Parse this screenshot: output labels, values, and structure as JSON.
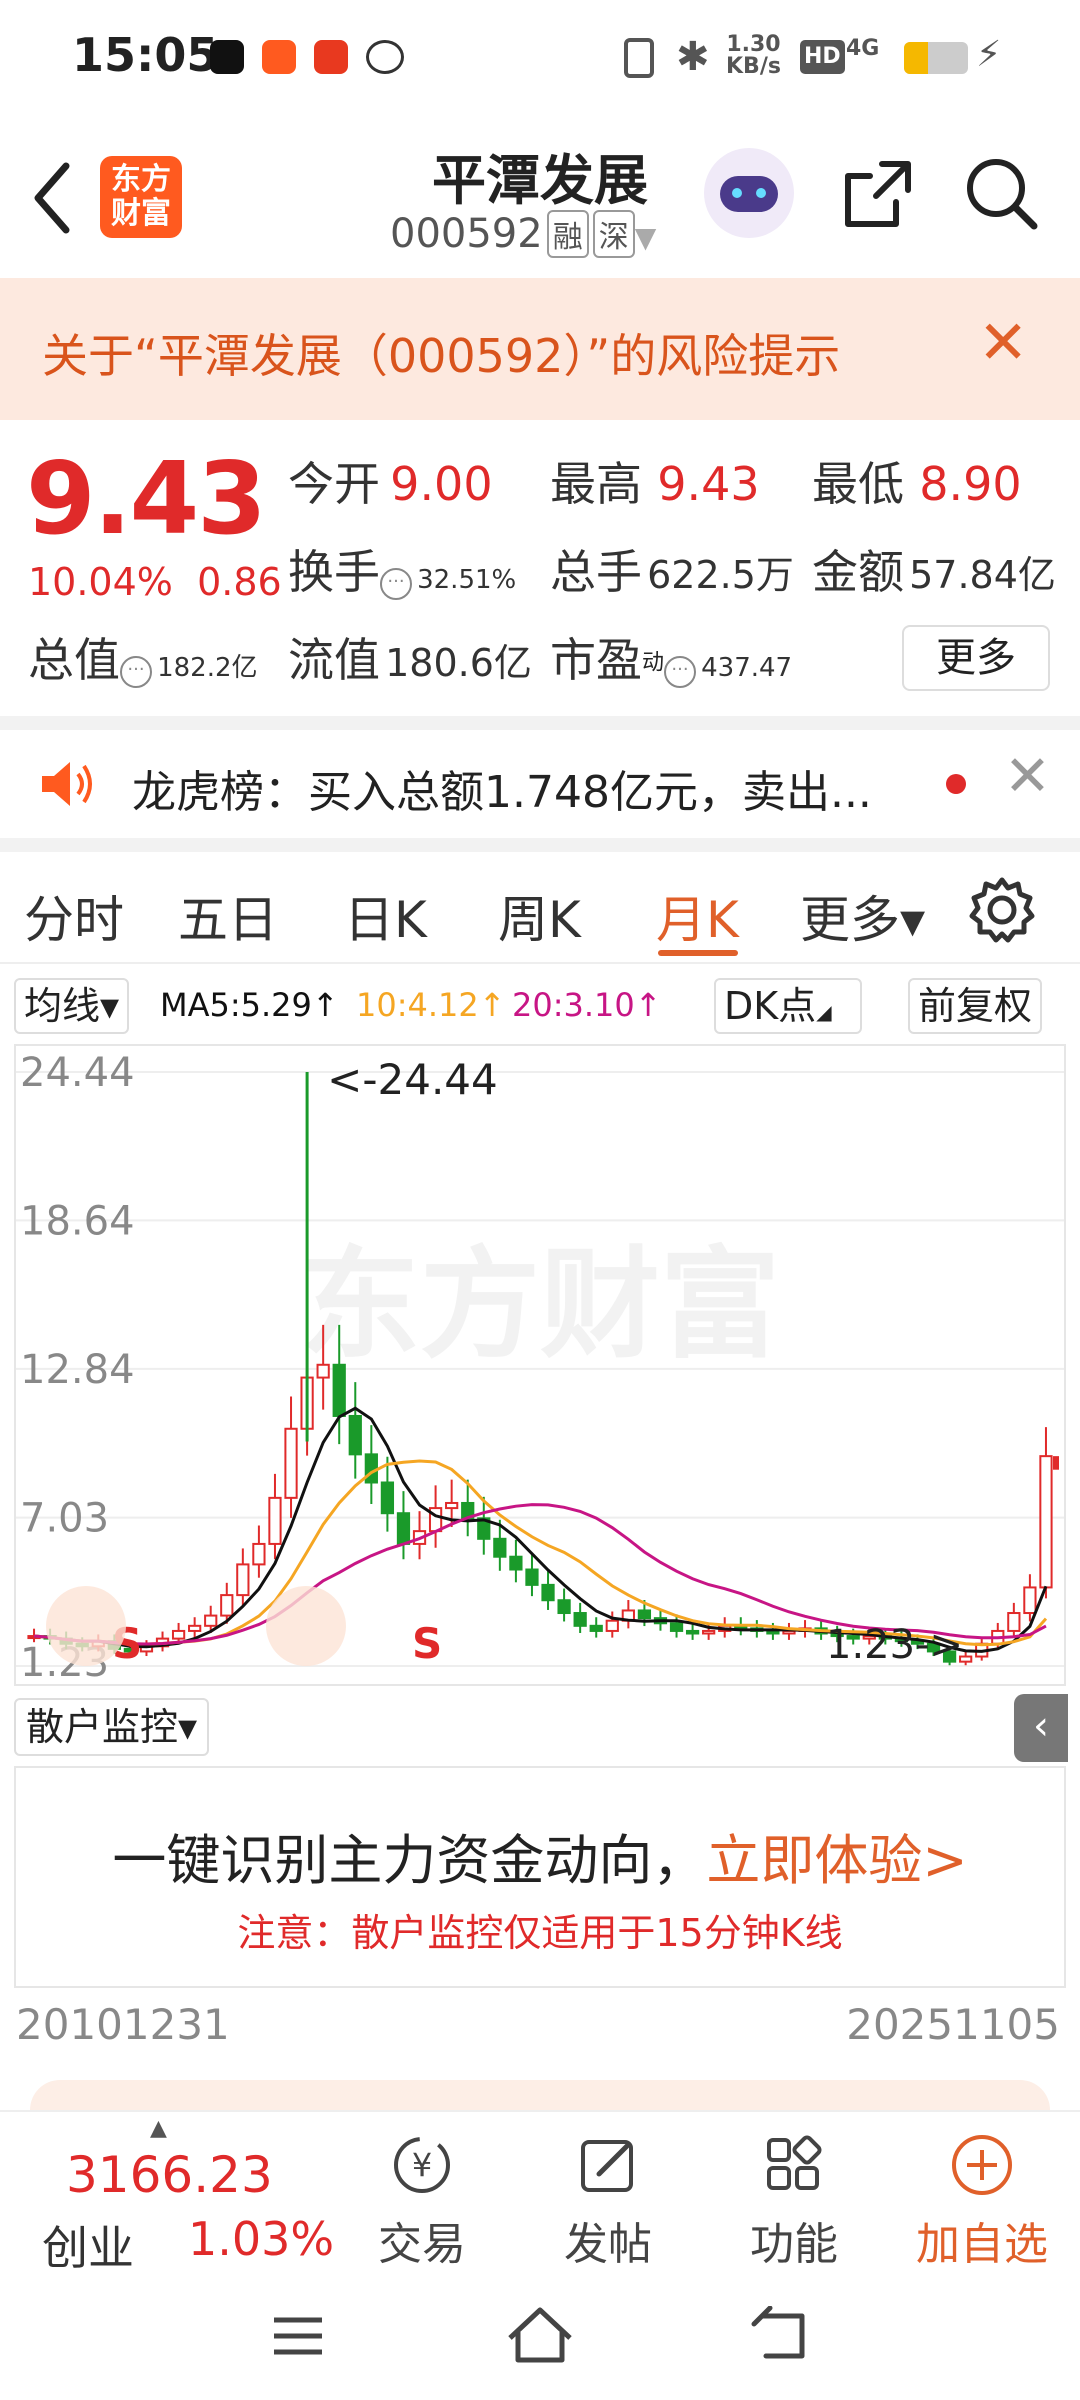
{
  "status_bar": {
    "time": "15:05",
    "net_speed_value": "1.30",
    "net_speed_unit": "KB/s",
    "hd": "HD",
    "network": "4G"
  },
  "header": {
    "logo_line1": "东方",
    "logo_line2": "财富",
    "title": "平潭发展",
    "code": "000592",
    "tag_margin": "融",
    "tag_market": "深"
  },
  "risk_banner": {
    "text": "关于“平潭发展（000592）”的风险提示",
    "close": "✕"
  },
  "quote": {
    "price": "9.43",
    "change_pct": "10.04%",
    "change_abs": "0.86",
    "open_label": "今开",
    "open_value": "9.00",
    "high_label": "最高",
    "high_value": "9.43",
    "low_label": "最低",
    "low_value": "8.90",
    "turnover_label": "换手",
    "turnover_value": "32.51%",
    "volume_label": "总手",
    "volume_value": "622.5万",
    "amount_label": "金额",
    "amount_value": "57.84亿",
    "mktcap_label": "总值",
    "mktcap_value": "182.2亿",
    "float_label": "流值",
    "float_value": "180.6亿",
    "pe_label": "市盈",
    "pe_sup": "动",
    "pe_value": "437.47",
    "more_button": "更多"
  },
  "news": {
    "text": "龙虎榜：买入总额1.748亿元，卖出...",
    "close": "✕"
  },
  "tabs": [
    {
      "label": "分时"
    },
    {
      "label": "五日"
    },
    {
      "label": "日K"
    },
    {
      "label": "周K"
    },
    {
      "label": "月K"
    },
    {
      "label": "更多▾"
    }
  ],
  "chart_controls": {
    "ma_select": "均线▾",
    "ma5": "MA5:5.29↑",
    "ma10": "10:4.12↑",
    "ma20": "20:3.10↑",
    "dk": "DK点",
    "adjust": "前复权"
  },
  "colors": {
    "accent": "#e0602a",
    "up_red": "#e02a2a",
    "down_green": "#1a9a2a",
    "ma5": "#111111",
    "ma10": "#f5a623",
    "ma20": "#c71585"
  },
  "chart_data": {
    "type": "candlestick",
    "period": "monthly",
    "y_ticks": [
      "24.44",
      "18.64",
      "12.84",
      "7.03",
      "1.23"
    ],
    "ylim": [
      1.23,
      24.44
    ],
    "annotations": {
      "max_label": "<-24.44",
      "min_label": "1.23->"
    },
    "markers": [
      "S",
      "S"
    ],
    "watermark": "东方财富",
    "close_series": [
      2.4,
      2.3,
      2.1,
      2.0,
      2.2,
      1.9,
      1.8,
      2.0,
      2.3,
      2.6,
      2.8,
      3.2,
      4.0,
      5.2,
      6.0,
      7.8,
      10.5,
      12.5,
      13.0,
      11.0,
      9.5,
      8.4,
      7.2,
      6.0,
      6.5,
      7.4,
      7.6,
      7.0,
      6.2,
      5.5,
      5.0,
      4.4,
      3.8,
      3.3,
      2.8,
      2.6,
      3.0,
      3.4,
      3.1,
      2.9,
      2.6,
      2.5,
      2.6,
      2.8,
      2.7,
      2.6,
      2.5,
      2.6,
      2.7,
      2.5,
      2.4,
      2.3,
      2.4,
      2.3,
      2.2,
      2.1,
      1.8,
      1.4,
      1.6,
      2.1,
      2.6,
      3.3,
      4.3,
      9.43
    ],
    "ma_current": {
      "ma5": 5.29,
      "ma10": 4.12,
      "ma20": 3.1
    }
  },
  "monitor": {
    "select": "散户监控▾",
    "main_text": "一键识别主力资金动向，",
    "cta": "立即体验>",
    "note": "注意：散户监控仅适用于15分钟K线",
    "collapse": "‹"
  },
  "dates": {
    "start": "20101231",
    "end": "20251105"
  },
  "bottom_bar": {
    "index_value": "3166.23",
    "index_name": "创业",
    "index_pct": "1.03%",
    "trade": "交易",
    "post": "发帖",
    "function": "功能",
    "add_watch": "加自选"
  }
}
